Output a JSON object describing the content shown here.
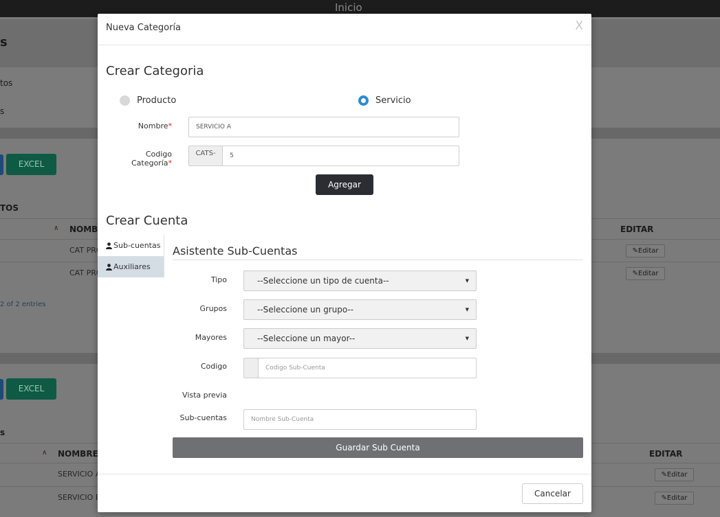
{
  "page": {
    "top_title": "Inicio"
  },
  "background": {
    "heading": "s",
    "nav_items": [
      "tos",
      "s"
    ],
    "excel_label": "EXCEL",
    "section1_label": "TOS",
    "section2_label": "s",
    "col_nombre": "NOMBR",
    "col_nombre_full": "NOMBRE",
    "col_editar": "EDITAR",
    "rows1": [
      "CAT PRO",
      "CAT PRO"
    ],
    "rows2": [
      "SERVICIO A",
      "SERVICIO B"
    ],
    "edit_label": "Editar",
    "entries_text": "2 of 2 entries"
  },
  "modal": {
    "title": "Nueva Categoría",
    "close_label": "X",
    "crear_categoria": {
      "heading": "Crear Categoria",
      "radio_producto": "Producto",
      "radio_servicio": "Servicio",
      "selected": "Servicio",
      "nombre_label": "Nombre",
      "nombre_value": "SERVICIO A",
      "codigo_label": "Codigo Categoría",
      "codigo_prefix": "CATS-",
      "codigo_value": "5",
      "required_mark": "*",
      "add_button": "Agregar"
    },
    "crear_cuenta": {
      "heading": "Crear Cuenta",
      "tabs": [
        "Sub-cuentas",
        "Auxiliares"
      ],
      "asistente_title": "Asistente Sub-Cuentas",
      "tipo_label": "Tipo",
      "tipo_value": "--Seleccione un tipo de cuenta--",
      "grupos_label": "Grupos",
      "grupos_value": "--Seleccione un grupo--",
      "mayores_label": "Mayores",
      "mayores_value": "--Seleccione un mayor--",
      "codigo_label": "Codigo",
      "codigo_placeholder": "Codigo Sub-Cuenta",
      "vista_previa_label": "Vista previa",
      "subcuentas_label": "Sub-cuentas",
      "subcuentas_placeholder": "Nombre Sub-Cuenta",
      "save_button": "Guardar Sub Cuenta"
    },
    "cancel_button": "Cancelar"
  }
}
